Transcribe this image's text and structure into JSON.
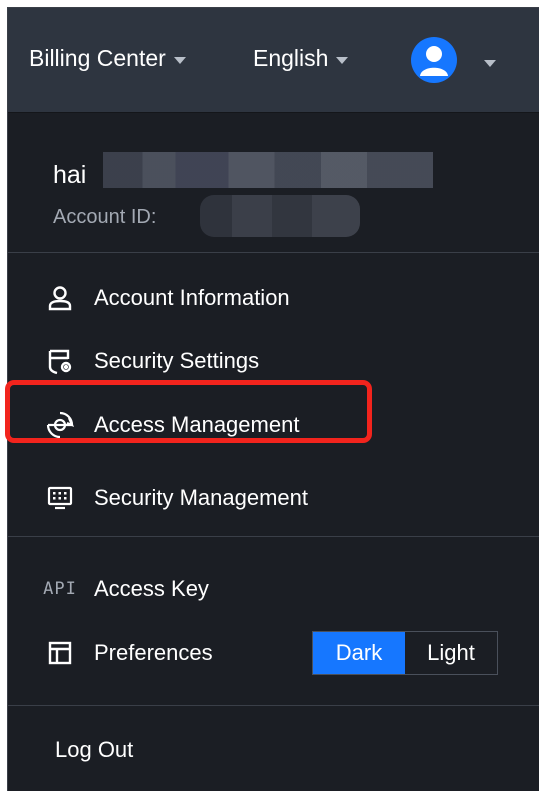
{
  "header": {
    "billing_label": "Billing Center",
    "language_label": "English",
    "avatar_icon": "user-avatar-icon"
  },
  "profile": {
    "username_visible": "hai",
    "account_id_label": "Account ID:"
  },
  "menu": {
    "primary": [
      {
        "label": "Account Information",
        "icon": "user-icon"
      },
      {
        "label": "Security Settings",
        "icon": "shield-settings-icon"
      },
      {
        "label": "Access Management",
        "icon": "access-management-icon"
      },
      {
        "label": "Security Management",
        "icon": "keyboard-icon"
      }
    ],
    "secondary": [
      {
        "label": "Access Key",
        "icon": "api-icon",
        "icon_text": "API"
      },
      {
        "label": "Preferences",
        "icon": "layout-icon"
      }
    ]
  },
  "theme_toggle": {
    "options": [
      "Dark",
      "Light"
    ],
    "selected": "Dark"
  },
  "logout_label": "Log Out",
  "colors": {
    "panel_bg": "#1b1e24",
    "topbar_bg": "#2e3540",
    "accent": "#1677ff",
    "highlight": "#f2241d"
  }
}
